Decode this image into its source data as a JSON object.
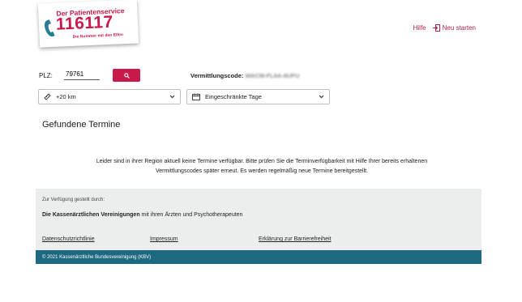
{
  "logo": {
    "title": "Der Patientenservice",
    "number": "116117",
    "subtitle": "Die Nummer mit den Elfen"
  },
  "header": {
    "help_label": "Hilfe",
    "restart_label": "Neu starten"
  },
  "search": {
    "plz_label": "PLZ:",
    "plz_value": "79761",
    "vermittlungscode_label": "Vermittlungscode:",
    "vermittlungscode_value": "WACM-FL6A-6UFU"
  },
  "filters": {
    "distance_label": "+20 km",
    "days_label": "Eingeschränkte Tage"
  },
  "main": {
    "heading": "Gefundene Termine",
    "message_line1": "Leider sind in ihrer Region aktuell keine Termine verfügbar. Bitte prüfen Sie die Terminverfügbarkeit mit Hilfe Ihrer bereits erhaltenen",
    "message_line2": "Vermittlungscodes später erneut. Es werden regelmäßig neue Termine bereitgestellt."
  },
  "footer": {
    "provided_by": "Zur Verfügung gestellt durch:",
    "kv_bold": "Die Kassenärztlichen Vereinigungen",
    "kv_rest": " mit ihren Ärzten und Psychotherapeuten",
    "links": [
      "Datenschutzrichtlinie",
      "Impressum",
      "Erklärung zur Barrierefreiheit"
    ],
    "copyright": "© 2021 Kassenärztliche Bundesvereinigung (KBV)"
  },
  "colors": {
    "brand": "#c8194a",
    "link": "#b1224c",
    "footer_bar": "#1d6a80",
    "footer_bg": "#eceeed"
  },
  "icons": [
    "phone-icon",
    "search-icon",
    "logout-icon",
    "ruler-icon",
    "calendar-icon",
    "chevron-down-icon"
  ]
}
